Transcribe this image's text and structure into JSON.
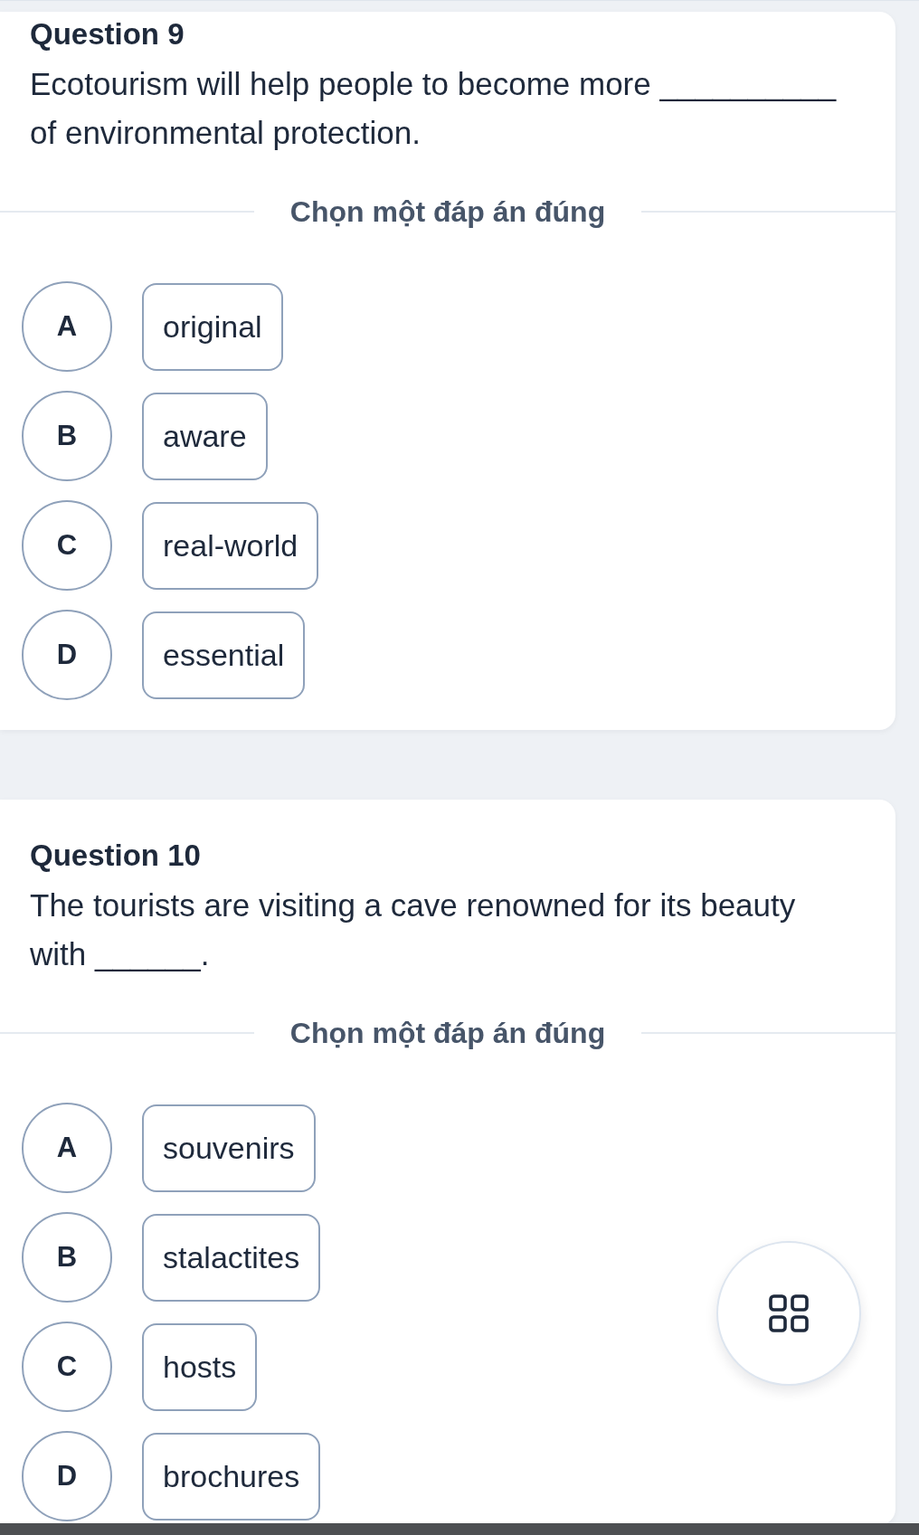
{
  "questions": [
    {
      "title": "Question 9",
      "text": "Ecotourism will help people to become more __________ of environmental protection.",
      "instruction": "Chọn một đáp án đúng",
      "options": [
        {
          "letter": "A",
          "text": "original",
          "selected": false
        },
        {
          "letter": "B",
          "text": "aware",
          "selected": false
        },
        {
          "letter": "C",
          "text": "real-world",
          "selected": false
        },
        {
          "letter": "D",
          "text": "essential",
          "selected": false
        }
      ]
    },
    {
      "title": "Question 10",
      "text": "The tourists are visiting a cave renowned for its beauty with ______.",
      "instruction": "Chọn một đáp án đúng",
      "options": [
        {
          "letter": "A",
          "text": "souvenirs",
          "selected": false
        },
        {
          "letter": "B",
          "text": "stalactites",
          "selected": false
        },
        {
          "letter": "C",
          "text": "hosts",
          "selected": false
        },
        {
          "letter": "D",
          "text": "brochures",
          "selected": false
        }
      ]
    }
  ]
}
